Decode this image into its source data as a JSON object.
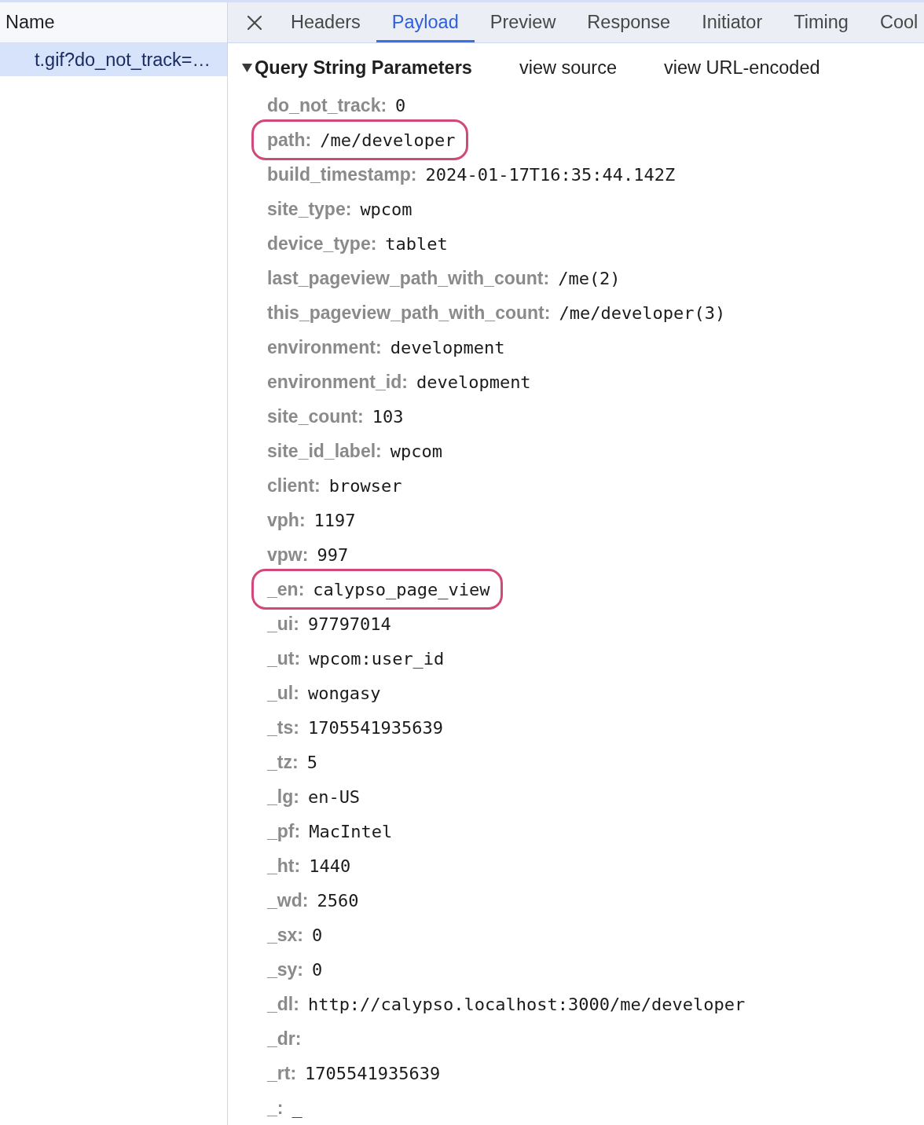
{
  "request_list": {
    "column_header": "Name",
    "requests": [
      {
        "name": "t.gif?do_not_track=…",
        "selected": true
      }
    ]
  },
  "detail_tabs": [
    {
      "label": "Headers",
      "selected": false
    },
    {
      "label": "Payload",
      "selected": true
    },
    {
      "label": "Preview",
      "selected": false
    },
    {
      "label": "Response",
      "selected": false
    },
    {
      "label": "Initiator",
      "selected": false
    },
    {
      "label": "Timing",
      "selected": false
    },
    {
      "label": "Cool",
      "selected": false
    }
  ],
  "payload": {
    "section": {
      "title": "Query String Parameters",
      "expanded": true,
      "links": [
        "view source",
        "view URL-encoded"
      ]
    },
    "params": [
      {
        "key": "do_not_track:",
        "value": "0",
        "highlighted": false
      },
      {
        "key": "path:",
        "value": "/me/developer",
        "highlighted": true
      },
      {
        "key": "build_timestamp:",
        "value": "2024-01-17T16:35:44.142Z",
        "highlighted": false
      },
      {
        "key": "site_type:",
        "value": "wpcom",
        "highlighted": false
      },
      {
        "key": "device_type:",
        "value": "tablet",
        "highlighted": false
      },
      {
        "key": "last_pageview_path_with_count:",
        "value": "/me(2)",
        "highlighted": false
      },
      {
        "key": "this_pageview_path_with_count:",
        "value": "/me/developer(3)",
        "highlighted": false
      },
      {
        "key": "environment:",
        "value": "development",
        "highlighted": false
      },
      {
        "key": "environment_id:",
        "value": "development",
        "highlighted": false
      },
      {
        "key": "site_count:",
        "value": "103",
        "highlighted": false
      },
      {
        "key": "site_id_label:",
        "value": "wpcom",
        "highlighted": false
      },
      {
        "key": "client:",
        "value": "browser",
        "highlighted": false
      },
      {
        "key": "vph:",
        "value": "1197",
        "highlighted": false
      },
      {
        "key": "vpw:",
        "value": "997",
        "highlighted": false
      },
      {
        "key": "_en:",
        "value": "calypso_page_view",
        "highlighted": true
      },
      {
        "key": "_ui:",
        "value": "97797014",
        "highlighted": false
      },
      {
        "key": "_ut:",
        "value": "wpcom:user_id",
        "highlighted": false
      },
      {
        "key": "_ul:",
        "value": "wongasy",
        "highlighted": false
      },
      {
        "key": "_ts:",
        "value": "1705541935639",
        "highlighted": false
      },
      {
        "key": "_tz:",
        "value": "5",
        "highlighted": false
      },
      {
        "key": "_lg:",
        "value": "en-US",
        "highlighted": false
      },
      {
        "key": "_pf:",
        "value": "MacIntel",
        "highlighted": false
      },
      {
        "key": "_ht:",
        "value": "1440",
        "highlighted": false
      },
      {
        "key": "_wd:",
        "value": "2560",
        "highlighted": false
      },
      {
        "key": "_sx:",
        "value": "0",
        "highlighted": false
      },
      {
        "key": "_sy:",
        "value": "0",
        "highlighted": false
      },
      {
        "key": "_dl:",
        "value": "http://calypso.localhost:3000/me/developer",
        "highlighted": false
      },
      {
        "key": "_dr:",
        "highlighted": false
      },
      {
        "key": "_rt:",
        "value": "1705541935639",
        "highlighted": false
      },
      {
        "key": "_:",
        "value": "_",
        "highlighted": false
      }
    ]
  }
}
